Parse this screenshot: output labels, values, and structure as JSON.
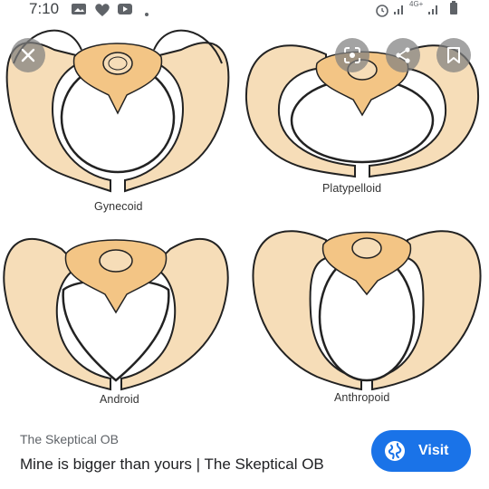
{
  "status_bar": {
    "time": "7:10",
    "network": "4G+",
    "icons": [
      "gallery-icon",
      "heart-icon",
      "youtube-icon",
      "dot-icon",
      "alarm-icon",
      "signal-icon",
      "signal-icon-2",
      "battery-icon"
    ]
  },
  "image": {
    "labels": {
      "gynecoid": "Gynecoid",
      "platypelloid": "Platypelloid",
      "android": "Android",
      "anthropoid": "Anthropoid"
    },
    "bone_color": "#f6ddb8",
    "sacrum_color": "#f3c585"
  },
  "overlay": {
    "buttons": [
      "close-icon",
      "lens-icon",
      "share-icon",
      "bookmark-icon"
    ]
  },
  "result": {
    "source": "The Skeptical OB",
    "title": "Mine is bigger than yours | The Skeptical OB",
    "visit_label": "Visit",
    "accent": "#1a73e8"
  }
}
